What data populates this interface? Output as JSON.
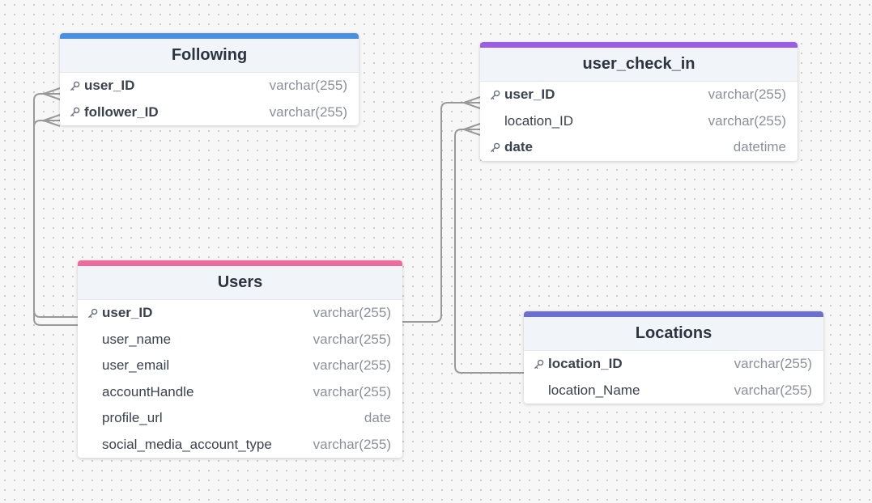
{
  "colors": {
    "following_accent": "#4a90e2",
    "user_check_in_accent": "#9b5de5",
    "users_accent": "#ee6b9e",
    "locations_accent": "#6b6fd1",
    "connector": "#999999"
  },
  "tables": {
    "following": {
      "title": "Following",
      "rows": [
        {
          "name": "user_ID",
          "type": "varchar(255)",
          "pk": true
        },
        {
          "name": "follower_ID",
          "type": "varchar(255)",
          "pk": true
        }
      ]
    },
    "user_check_in": {
      "title": "user_check_in",
      "rows": [
        {
          "name": "user_ID",
          "type": "varchar(255)",
          "pk": true
        },
        {
          "name": "location_ID",
          "type": "varchar(255)",
          "pk": false
        },
        {
          "name": "date",
          "type": "datetime",
          "pk": true
        }
      ]
    },
    "users": {
      "title": "Users",
      "rows": [
        {
          "name": "user_ID",
          "type": "varchar(255)",
          "pk": true
        },
        {
          "name": "user_name",
          "type": "varchar(255)",
          "pk": false
        },
        {
          "name": "user_email",
          "type": "varchar(255)",
          "pk": false
        },
        {
          "name": "accountHandle",
          "type": "varchar(255)",
          "pk": false
        },
        {
          "name": "profile_url",
          "type": "date",
          "pk": false
        },
        {
          "name": "social_media_account_type",
          "type": "varchar(255)",
          "pk": false
        }
      ]
    },
    "locations": {
      "title": "Locations",
      "rows": [
        {
          "name": "location_ID",
          "type": "varchar(255)",
          "pk": true
        },
        {
          "name": "location_Name",
          "type": "varchar(255)",
          "pk": false
        }
      ]
    }
  }
}
